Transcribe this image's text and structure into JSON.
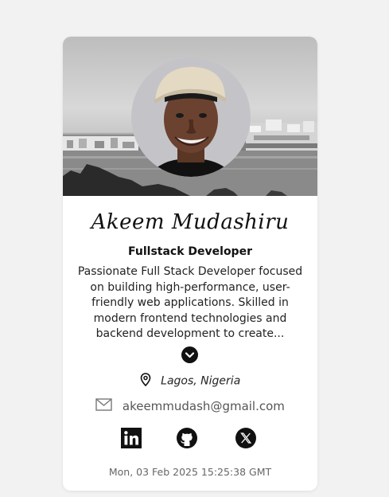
{
  "profile": {
    "name": "Akeem Mudashiru",
    "role": "Fullstack Developer",
    "bio_lines": [
      "Passionate Full Stack Developer focused",
      "on building high-performance, user-",
      "friendly web applications. Skilled in",
      "modern frontend technologies and",
      "backend development to create..."
    ],
    "location": "Lagos, Nigeria",
    "email": "akeemmudash@gmail.com",
    "timestamp": "Mon, 03 Feb 2025 15:25:38 GMT"
  },
  "icons": {
    "expand": "chevron-down-icon",
    "location": "location-pin-icon",
    "email": "mail-icon",
    "linkedin": "linkedin-icon",
    "github": "github-icon",
    "x": "x-icon"
  },
  "colors": {
    "background": "#f2f2f2",
    "card": "#ffffff",
    "text": "#111111"
  }
}
